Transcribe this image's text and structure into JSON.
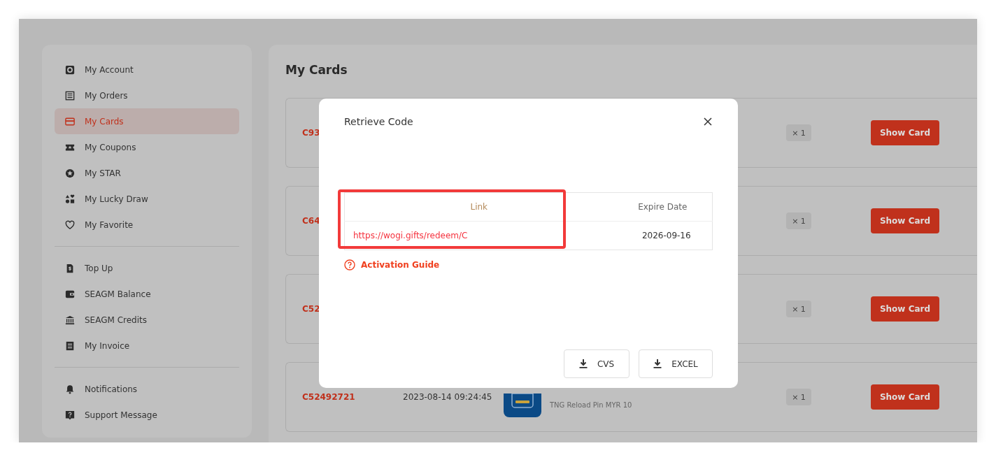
{
  "sidebar": {
    "groups": [
      {
        "items": [
          {
            "label": "My Account",
            "selected": false
          },
          {
            "label": "My Orders",
            "selected": false
          },
          {
            "label": "My Cards",
            "selected": true
          },
          {
            "label": "My Coupons",
            "selected": false
          },
          {
            "label": "My STAR",
            "selected": false
          },
          {
            "label": "My Lucky Draw",
            "selected": false
          },
          {
            "label": "My Favorite",
            "selected": false
          }
        ]
      },
      {
        "items": [
          {
            "label": "Top Up",
            "selected": false
          },
          {
            "label": "SEAGM Balance",
            "selected": false
          },
          {
            "label": "SEAGM Credits",
            "selected": false
          },
          {
            "label": "My Invoice",
            "selected": false
          }
        ]
      },
      {
        "items": [
          {
            "label": "Notifications",
            "selected": false
          },
          {
            "label": "Support Message",
            "selected": false
          }
        ]
      }
    ]
  },
  "main": {
    "title": "My Cards",
    "cards": [
      {
        "id": "C93",
        "quantity": "× 1",
        "button": "Show Card"
      },
      {
        "id": "C64",
        "quantity": "× 1",
        "button": "Show Card"
      },
      {
        "id": "C52",
        "quantity": "× 1",
        "button": "Show Card"
      },
      {
        "id": "C52492721",
        "date": "2023-08-14 09:24:45",
        "variant": "TNG Reload Pin MYR 10",
        "quantity": "× 1",
        "button": "Show Card"
      }
    ]
  },
  "modal": {
    "title": "Retrieve Code",
    "table": {
      "columns": [
        "Link",
        "Expire Date"
      ],
      "rows": [
        [
          "https://wogi.gifts/redeem/C",
          "2026-09-16"
        ]
      ]
    },
    "highlight": true,
    "guide": "Activation Guide",
    "buttons": [
      "CVS",
      "EXCEL"
    ]
  }
}
